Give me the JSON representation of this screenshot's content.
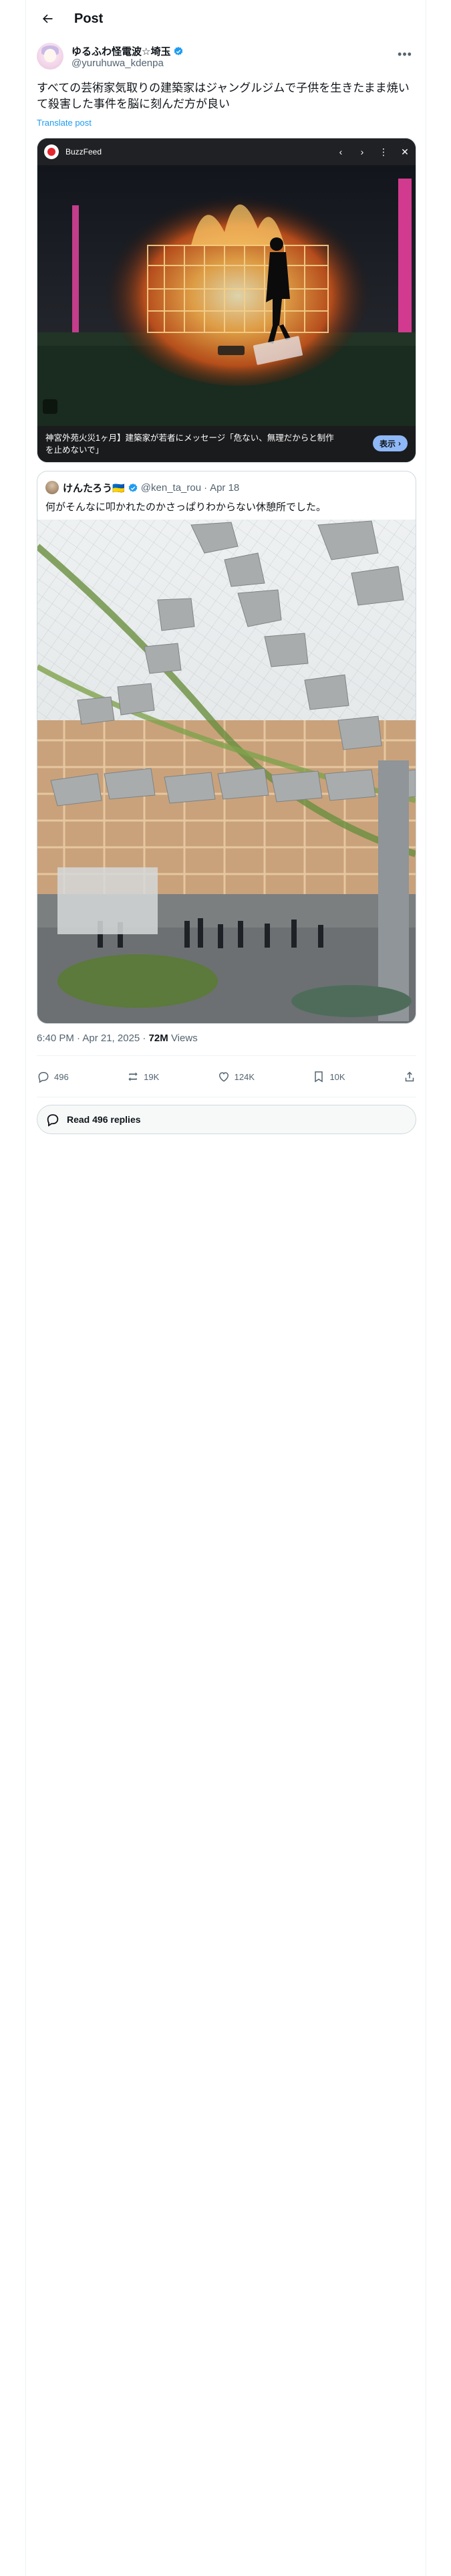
{
  "header": {
    "title": "Post"
  },
  "author": {
    "name": "ゆるふわ怪電波☆埼玉",
    "handle": "@yuruhuwa_kdenpa",
    "verified": true
  },
  "tweet": {
    "text": "すべての芸術家気取りの建築家はジャングルジムで子供を生きたまま焼いて殺害した事件を脳に刻んだ方が良い",
    "translate_label": "Translate post"
  },
  "video": {
    "channel": "BuzzFeed",
    "caption": "神宮外苑火災1ヶ月】建築家が若者にメッセージ「危ない、無理だからと制作を止めないで」",
    "watch_label": "表示"
  },
  "quote": {
    "name": "けんたろう🇺🇦",
    "handle": "@ken_ta_rou",
    "separator": "·",
    "date": "Apr 18",
    "text": "何がそんなに叩かれたのかさっぱりわからない休憩所でした。"
  },
  "meta": {
    "time": "6:40 PM · Apr 21, 2025 · ",
    "views_count": "72M",
    "views_label": " Views"
  },
  "actions": {
    "replies": "496",
    "reposts": "19K",
    "likes": "124K",
    "bookmarks": "10K"
  },
  "read_replies": "Read 496 replies",
  "colors": {
    "accent": "#1d9bf0",
    "text": "#0f1419",
    "muted": "#536471",
    "border": "#cfd9de"
  }
}
